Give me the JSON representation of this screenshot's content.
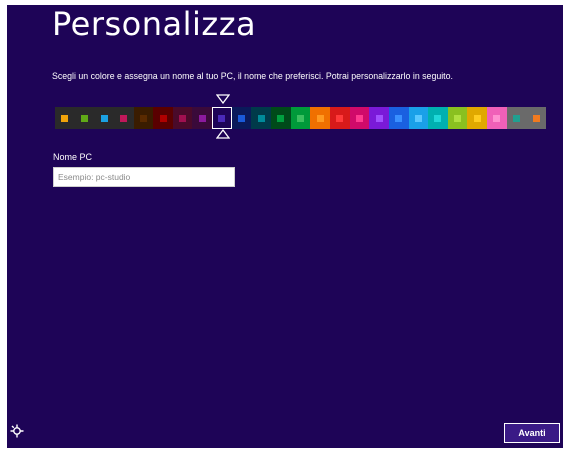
{
  "header": {
    "title": "Personalizza"
  },
  "intro": {
    "text": "Scegli un colore e assegna un nome al tuo PC, il nome che preferisci. Potrai personalizzarlo in seguito."
  },
  "palette": {
    "selected_index": 8,
    "swatches": [
      {
        "bg": "#2a2a2a",
        "fg": "#f0a30a"
      },
      {
        "bg": "#2a2a2a",
        "fg": "#60a917"
      },
      {
        "bg": "#2a2a2a",
        "fg": "#1ba1e2"
      },
      {
        "bg": "#2a2a2a",
        "fg": "#c0185a"
      },
      {
        "bg": "#3a1c00",
        "fg": "#5a2a00"
      },
      {
        "bg": "#5a0000",
        "fg": "#b00000"
      },
      {
        "bg": "#4a0a2a",
        "fg": "#a01050"
      },
      {
        "bg": "#3a0a3a",
        "fg": "#8b1a9e"
      },
      {
        "bg": "#1e0457",
        "fg": "#4a2ab8"
      },
      {
        "bg": "#0a1a5a",
        "fg": "#1a5ad8"
      },
      {
        "bg": "#003a4a",
        "fg": "#008a9a"
      },
      {
        "bg": "#004a1a",
        "fg": "#00a040"
      },
      {
        "bg": "#009a3a",
        "fg": "#3cc060"
      },
      {
        "bg": "#f07000",
        "fg": "#ff9a20"
      },
      {
        "bg": "#d81a1a",
        "fg": "#ff3a3a"
      },
      {
        "bg": "#d00a6a",
        "fg": "#ff3a90"
      },
      {
        "bg": "#7a1ad8",
        "fg": "#a050ff"
      },
      {
        "bg": "#1a60e0",
        "fg": "#3a90ff"
      },
      {
        "bg": "#1aa0e8",
        "fg": "#5ac8ff"
      },
      {
        "bg": "#00b0b0",
        "fg": "#20d8d8"
      },
      {
        "bg": "#8ac020",
        "fg": "#b0e040"
      },
      {
        "bg": "#e0a800",
        "fg": "#ffcc20"
      },
      {
        "bg": "#f060b8",
        "fg": "#ff90d0"
      },
      {
        "bg": "#6a6a6a",
        "fg": "#20a090"
      },
      {
        "bg": "#6a6a6a",
        "fg": "#f07a20"
      }
    ]
  },
  "pc_name": {
    "label": "Nome PC",
    "value": "",
    "placeholder": "Esempio: pc-studio"
  },
  "footer": {
    "ease_icon": "ease-of-access-icon",
    "next_label": "Avanti"
  }
}
